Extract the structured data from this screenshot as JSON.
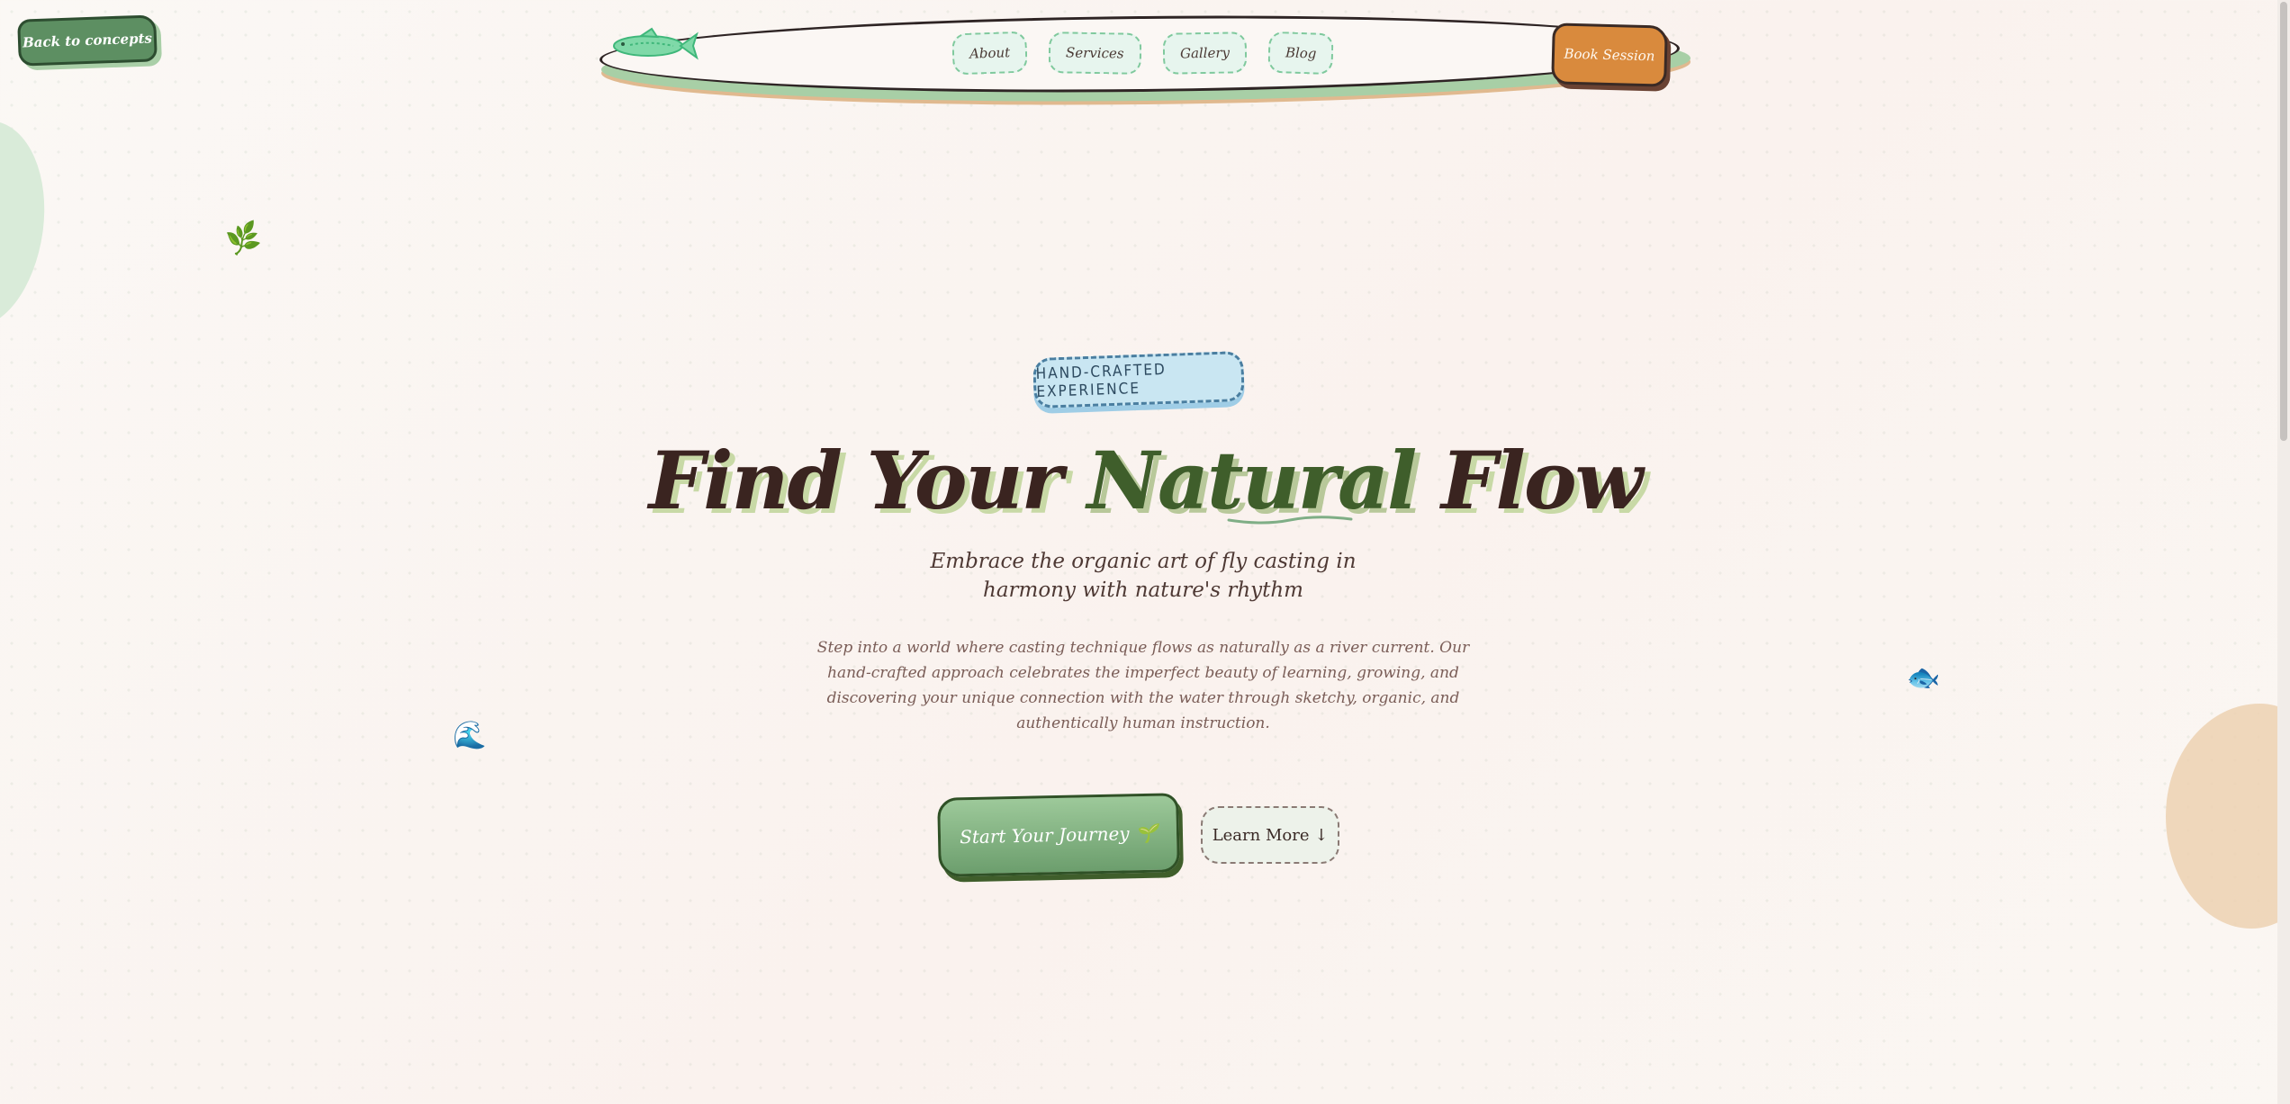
{
  "back_button": {
    "label": "Back to concepts"
  },
  "nav": {
    "logo_icon": "trout-fish-icon",
    "links": [
      "About",
      "Services",
      "Gallery",
      "Blog"
    ],
    "book_label": "Book Session"
  },
  "decor": {
    "leaf": "🌿",
    "wave": "🌊",
    "fish": "🐟"
  },
  "hero": {
    "tag": "HAND-CRAFTED EXPERIENCE",
    "headline_a": "Find Your ",
    "headline_b": "Natural",
    "headline_c": " Flow",
    "subtitle": "Embrace the organic art of fly casting in harmony with nature's rhythm",
    "body": "Step into a world where casting technique flows as naturally as a river current. Our hand-crafted approach celebrates the imperfect beauty of learning, growing, and discovering your unique connection with the water through sketchy, organic, and authentically human instruction.",
    "cta_label": "Start Your Journey 🌱",
    "learn_label": "Learn More ↓"
  },
  "colors": {
    "primary_green": "#5d8f62",
    "accent_orange": "#d98a3d",
    "sky_blue": "#c9e6f2",
    "ink": "#3a2420"
  }
}
